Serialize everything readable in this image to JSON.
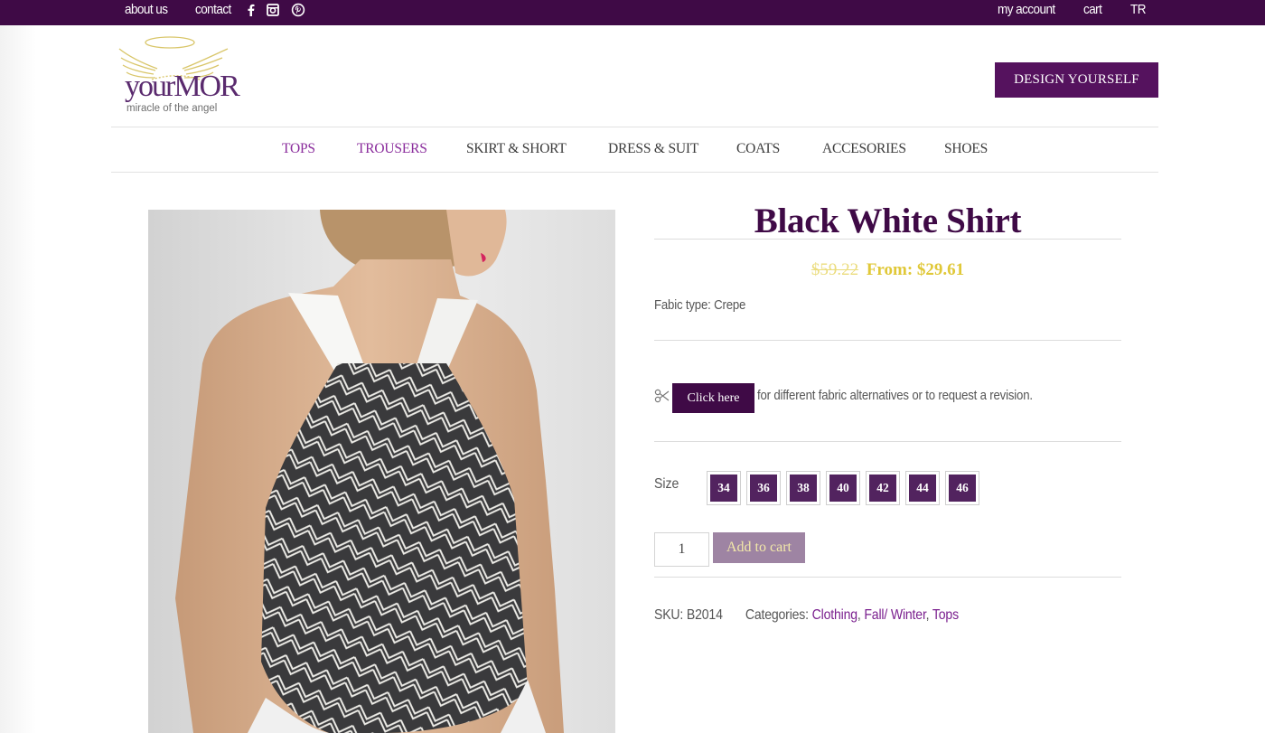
{
  "topbar": {
    "left_links": [
      {
        "label": "about us"
      },
      {
        "label": "contact"
      }
    ],
    "social_icons": [
      "facebook-icon",
      "instagram-icon",
      "pinterest-icon"
    ],
    "right_links": [
      {
        "label": "my account"
      },
      {
        "label": "cart"
      },
      {
        "label": "TR"
      }
    ]
  },
  "header": {
    "logo_text": "yourMOR",
    "logo_tagline": "miracle of the angel",
    "design_button": "DESIGN YOURSELF"
  },
  "nav": {
    "items": [
      {
        "label": "TOPS",
        "active": true
      },
      {
        "label": "TROUSERS",
        "active": true
      },
      {
        "label": "SKIRT & SHORT",
        "active": false
      },
      {
        "label": "DRESS & SUIT",
        "active": false
      },
      {
        "label": "COATS",
        "active": false
      },
      {
        "label": "ACCESORIES",
        "active": false
      },
      {
        "label": "SHOES",
        "active": false
      }
    ]
  },
  "product": {
    "image_alt": "Model wearing black and white geometric print halter shirt, back view",
    "title": "Black White Shirt",
    "old_price": "$59.22",
    "price": "From: $29.61",
    "fabric": "Fabic type: Crepe",
    "click_here": "Click here",
    "revision_text": "for different fabric alternatives or to request a revision.",
    "size_label": "Size",
    "sizes": [
      "34",
      "36",
      "38",
      "40",
      "42",
      "44",
      "46"
    ],
    "quantity": "1",
    "add_to_cart": "Add to cart",
    "sku_label": "SKU:",
    "sku": "B2014",
    "categories_label": "Categories:",
    "categories": [
      "Clothing",
      "Fall/ Winter",
      "Tops"
    ]
  },
  "colors": {
    "brand_purple": "#3f0a46",
    "button_purple": "#55125e",
    "size_purple": "#52235f",
    "price_gold": "#e0c838",
    "link_purple": "#7a1f8e",
    "add_to_cart_bg": "#9e84a3"
  }
}
